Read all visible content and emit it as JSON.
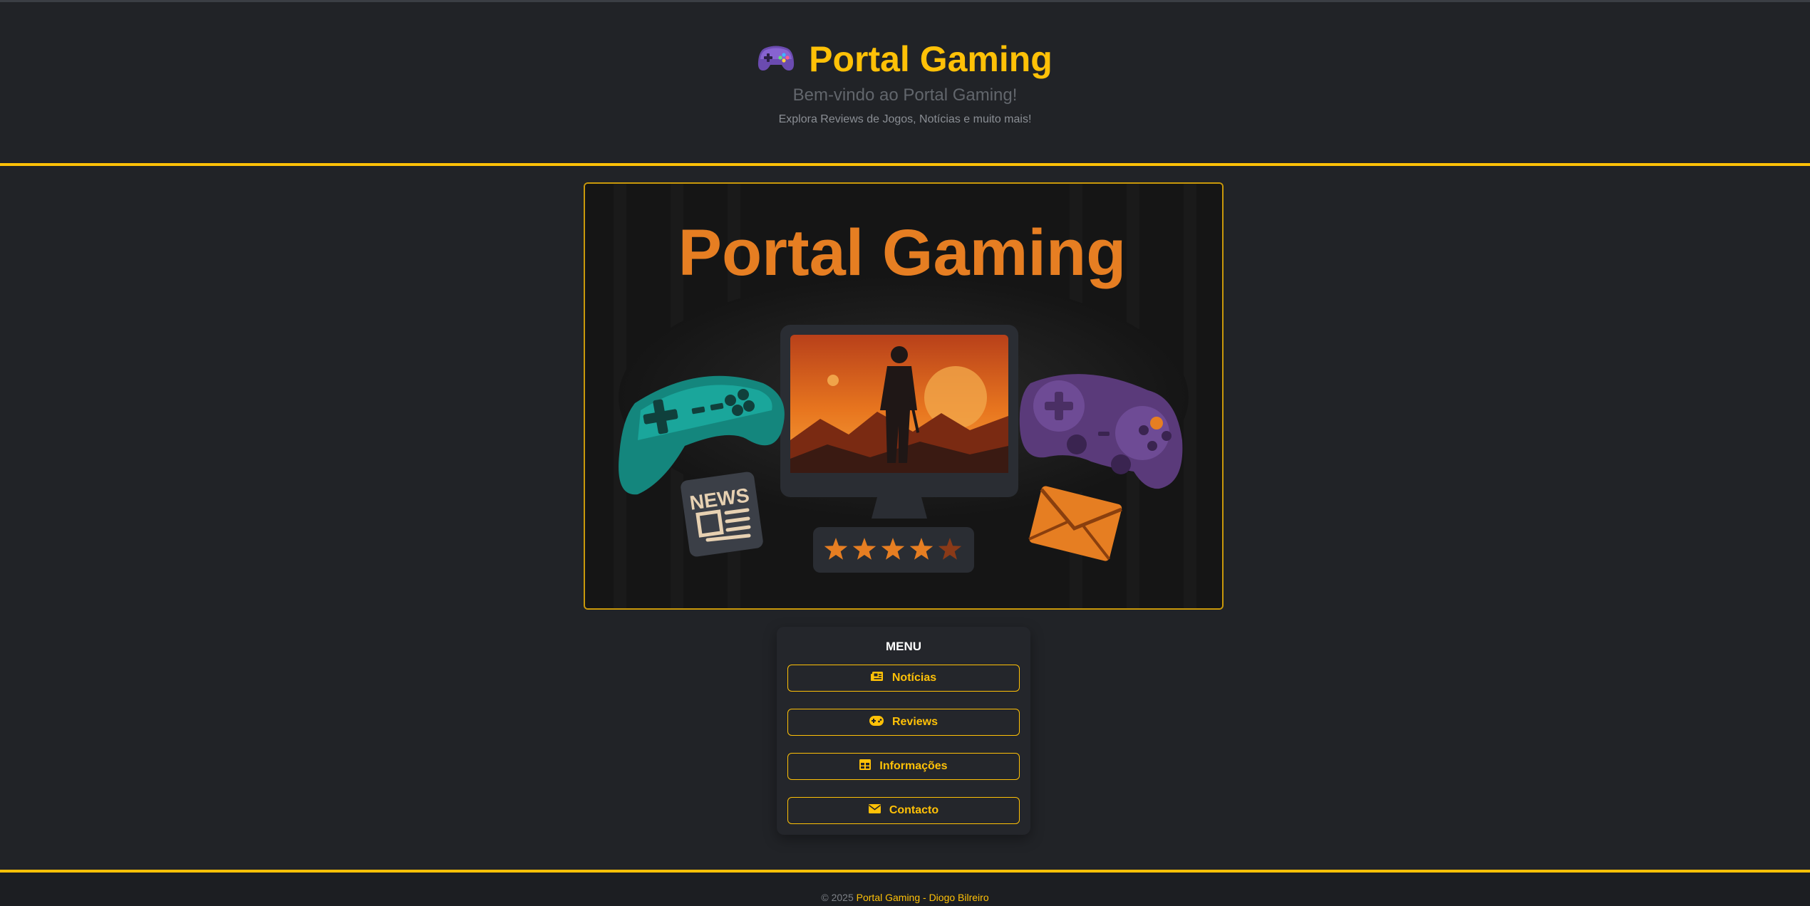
{
  "header": {
    "icon": "gamepad-icon",
    "title": "Portal Gaming",
    "subtitle": "Bem-vindo ao Portal Gaming!",
    "tagline": "Explora Reviews de Jogos, Notícias e muito mais!"
  },
  "hero": {
    "title": "Portal Gaming",
    "badge_text": "NEWS",
    "rating_stars": 4,
    "rating_max": 5
  },
  "menu": {
    "title": "MENU",
    "items": [
      {
        "label": "Notícias",
        "icon": "newspaper-icon"
      },
      {
        "label": "Reviews",
        "icon": "gamepad-icon"
      },
      {
        "label": "Informações",
        "icon": "table-icon"
      },
      {
        "label": "Contacto",
        "icon": "envelope-icon"
      }
    ]
  },
  "footer": {
    "copyright": "© 2025",
    "credit": "Portal Gaming - Diogo Bilreiro"
  },
  "colors": {
    "accent": "#ffc107",
    "background": "#212327",
    "hero_title": "#e67e22"
  }
}
